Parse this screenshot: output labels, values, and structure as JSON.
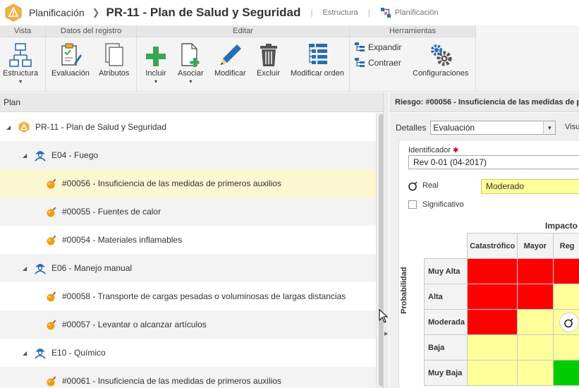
{
  "titlebar": {
    "app_name": "Planificación",
    "current_record": "PR-11 - Plan de Salud y Seguridad",
    "link_structure": "Estructura",
    "link_planning": "Planificación"
  },
  "ribbon": {
    "groups": {
      "vista": "Vista",
      "datos": "Datos del registro",
      "editar": "Editar",
      "herramientas": "Herramientas"
    },
    "buttons": {
      "estructura": "Estructura",
      "evaluacion": "Evaluación",
      "atributos": "Atributos",
      "incluir": "Incluir",
      "asociar": "Asociar",
      "modificar": "Modificar",
      "excluir": "Excluir",
      "modificar_orden": "Modificar orden",
      "expandir": "Expandir",
      "contraer": "Contraer",
      "configuraciones": "Configuraciones"
    },
    "dropdown_marker": "▾"
  },
  "plan_panel": {
    "title": "Plan",
    "rows": [
      {
        "label": "PR-11 - Plan de Salud y Seguridad",
        "icon": "warning-plan-icon"
      },
      {
        "label": "E04 - Fuego",
        "icon": "worker-icon"
      },
      {
        "label": "#00056 - Insuficiencia de las medidas de primeros auxilios",
        "icon": "bomb-icon"
      },
      {
        "label": "#00055 - Fuentes de calor",
        "icon": "bomb-icon"
      },
      {
        "label": "#00054 - Materiales inflamables",
        "icon": "bomb-icon"
      },
      {
        "label": "E06 - Manejo manual",
        "icon": "worker-icon"
      },
      {
        "label": "#00058 - Transporte de cargas pesadas o voluminosas de largas distancias",
        "icon": "bomb-icon"
      },
      {
        "label": "#00057 - Levantar o alcanzar artículos",
        "icon": "bomb-icon"
      },
      {
        "label": "E10 - Químico",
        "icon": "worker-icon"
      },
      {
        "label": "#00061 - Insuficiencia de las medidas de primeros auxilios",
        "icon": "bomb-icon"
      }
    ]
  },
  "detail_panel": {
    "title": "Riesgo: #00056 - Insuficiencia de las medidas de p",
    "details_label": "Detalles",
    "details_value": "Evaluación",
    "visu_label": "Visu",
    "identifier_label": "Identificador",
    "identifier_value": "Rev 0-01 (04-2017)",
    "real_label": "Real",
    "real_value": "Moderado",
    "significant_label": "Significativo",
    "impact_label": "Impacto",
    "probability_label": "Probabilidad",
    "matrix": {
      "columns": [
        "Catastrófico",
        "Mayor",
        "Reg"
      ],
      "rows": [
        {
          "label": "Muy Alta",
          "colors": [
            "#ff0000",
            "#ff0000",
            "#ff0000"
          ]
        },
        {
          "label": "Alta",
          "colors": [
            "#ff0000",
            "#ff0000",
            "#ffff99"
          ]
        },
        {
          "label": "Moderada",
          "colors": [
            "#ff0000",
            "#ffff99",
            "#ffff99"
          ]
        },
        {
          "label": "Baja",
          "colors": [
            "#ffff99",
            "#ffff99",
            "#ffff99"
          ]
        },
        {
          "label": "Muy Baja",
          "colors": [
            "#ffff99",
            "#ffff99",
            "#00cc00"
          ]
        }
      ]
    }
  },
  "colors": {
    "accent_orange": "#f5a623",
    "selected_row": "#fbf7d0",
    "ribbon_blue": "#2b6db5",
    "ribbon_green": "#3aa655"
  }
}
